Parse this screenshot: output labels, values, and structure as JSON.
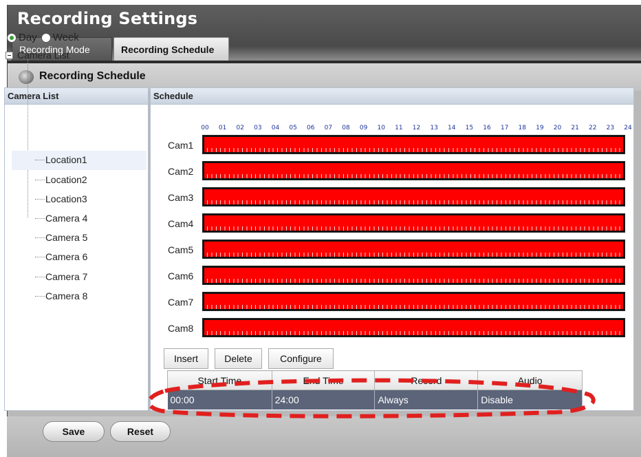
{
  "window": {
    "title": "Recording Settings"
  },
  "tabs": [
    {
      "label": "Recording Mode",
      "active": false
    },
    {
      "label": "Recording Schedule",
      "active": true
    }
  ],
  "section": {
    "title": "Recording Schedule",
    "icon": "camera-lens-icon"
  },
  "camera_list": {
    "header": "Camera List",
    "view_modes": [
      {
        "label": "Day",
        "selected": true
      },
      {
        "label": "Week",
        "selected": false
      }
    ],
    "root_label": "Camera List",
    "items": [
      {
        "label": "Location1",
        "selected": true
      },
      {
        "label": "Location2",
        "selected": false
      },
      {
        "label": "Location3",
        "selected": false
      },
      {
        "label": "Camera 4",
        "selected": false
      },
      {
        "label": "Camera 5",
        "selected": false
      },
      {
        "label": "Camera 6",
        "selected": false
      },
      {
        "label": "Camera 7",
        "selected": false
      },
      {
        "label": "Camera 8",
        "selected": false
      }
    ]
  },
  "schedule": {
    "header": "Schedule",
    "hours": [
      "00",
      "01",
      "02",
      "03",
      "04",
      "05",
      "06",
      "07",
      "08",
      "09",
      "10",
      "11",
      "12",
      "13",
      "14",
      "15",
      "16",
      "17",
      "18",
      "19",
      "20",
      "21",
      "22",
      "23",
      "24"
    ],
    "cameras": [
      {
        "label": "Cam1",
        "start": 0,
        "end": 24
      },
      {
        "label": "Cam2",
        "start": 0,
        "end": 24
      },
      {
        "label": "Cam3",
        "start": 0,
        "end": 24
      },
      {
        "label": "Cam4",
        "start": 0,
        "end": 24
      },
      {
        "label": "Cam5",
        "start": 0,
        "end": 24
      },
      {
        "label": "Cam6",
        "start": 0,
        "end": 24
      },
      {
        "label": "Cam7",
        "start": 0,
        "end": 24
      },
      {
        "label": "Cam8",
        "start": 0,
        "end": 24
      }
    ],
    "bar_color": "#ff0000",
    "buttons": {
      "insert": "Insert",
      "delete": "Delete",
      "configure": "Configure"
    },
    "table": {
      "columns": [
        "Start Time",
        "End Time",
        "Record",
        "Audio"
      ],
      "rows": [
        {
          "start_time": "00:00",
          "end_time": "24:00",
          "record": "Always",
          "audio": "Disable"
        }
      ]
    },
    "highlight_color": "#e0201f"
  },
  "footer": {
    "save_label": "Save",
    "reset_label": "Reset"
  }
}
